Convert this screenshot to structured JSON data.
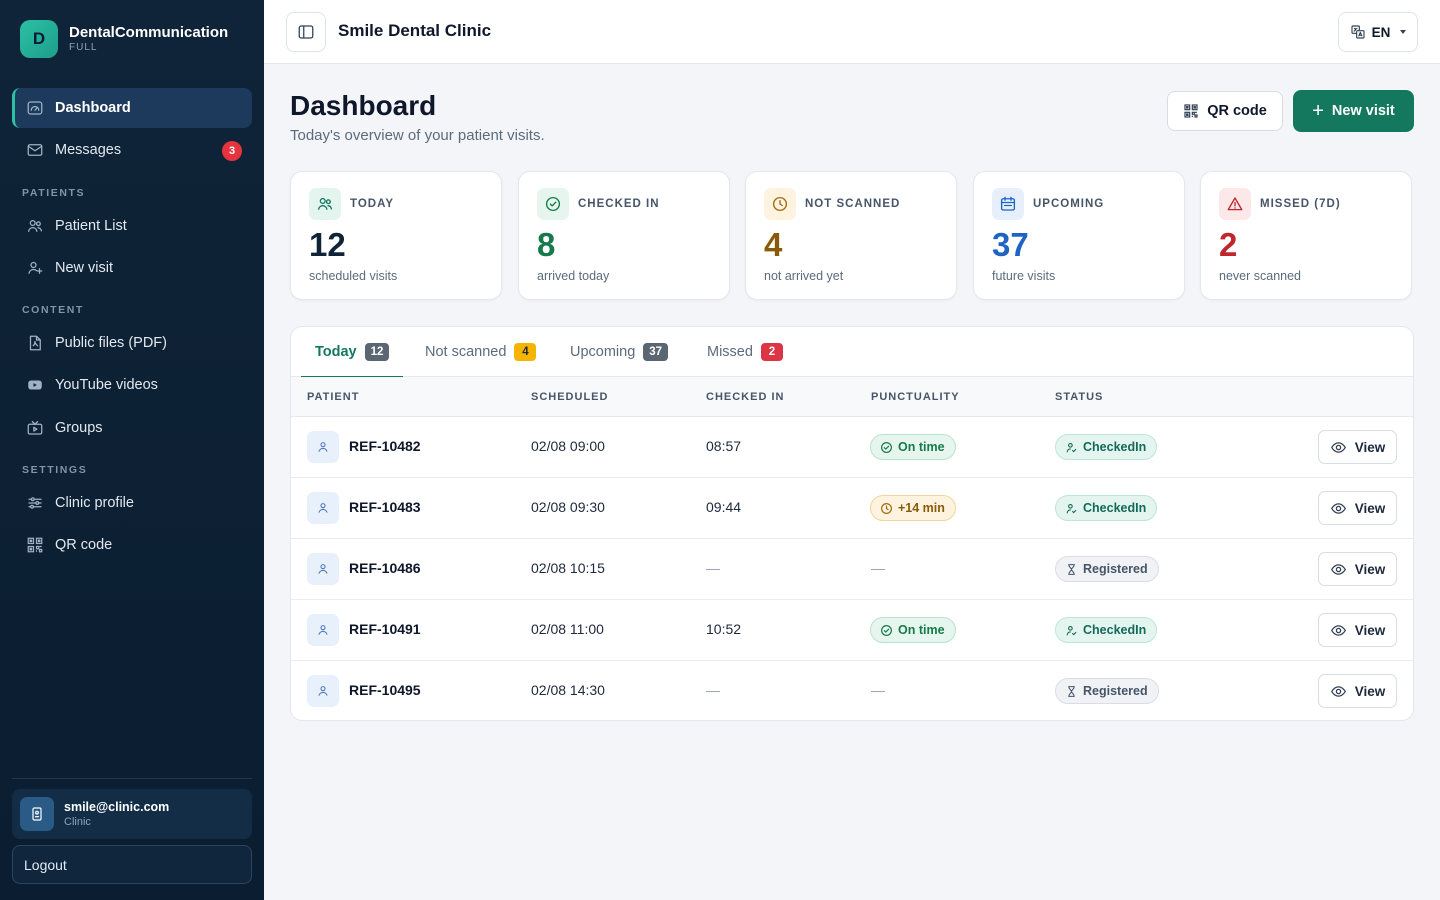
{
  "brand": {
    "initial": "D",
    "name": "DentalCommunication",
    "plan": "FULL"
  },
  "sidebar": {
    "dashboard": "Dashboard",
    "messages": "Messages",
    "messages_badge": "3",
    "section_patients": "PATIENTS",
    "patient_list": "Patient List",
    "new_visit": "New visit",
    "section_content": "CONTENT",
    "public_files": "Public files (PDF)",
    "youtube": "YouTube videos",
    "groups": "Groups",
    "section_settings": "SETTINGS",
    "clinic_profile": "Clinic profile",
    "qr_code": "QR code"
  },
  "user": {
    "email": "smile@clinic.com",
    "role": "Clinic"
  },
  "logout_label": "Logout",
  "topbar": {
    "clinic_name": "Smile Dental Clinic",
    "lang": "EN"
  },
  "page": {
    "title": "Dashboard",
    "subtitle": "Today's overview of your patient visits.",
    "qr_button": "QR code",
    "new_visit_button": "New visit"
  },
  "stats": [
    {
      "label": "TODAY",
      "value": "12",
      "desc": "scheduled visits",
      "color": "#0f2438"
    },
    {
      "label": "CHECKED IN",
      "value": "8",
      "desc": "arrived today",
      "color": "#167a4a"
    },
    {
      "label": "NOT SCANNED",
      "value": "4",
      "desc": "not arrived yet",
      "color": "#8a5a0b"
    },
    {
      "label": "UPCOMING",
      "value": "37",
      "desc": "future visits",
      "color": "#1f63c4"
    },
    {
      "label": "MISSED (7D)",
      "value": "2",
      "desc": "never scanned",
      "color": "#c0262d"
    }
  ],
  "tabs": [
    {
      "label": "Today",
      "count": "12"
    },
    {
      "label": "Not scanned",
      "count": "4"
    },
    {
      "label": "Upcoming",
      "count": "37"
    },
    {
      "label": "Missed",
      "count": "2"
    }
  ],
  "table": {
    "headers": [
      "PATIENT",
      "SCHEDULED",
      "CHECKED IN",
      "PUNCTUALITY",
      "STATUS"
    ],
    "view_label": "View",
    "rows": [
      {
        "ref": "REF-10482",
        "scheduled": "02/08 09:00",
        "checked_in": "08:57",
        "punctuality": "On time",
        "status": "CheckedIn"
      },
      {
        "ref": "REF-10483",
        "scheduled": "02/08 09:30",
        "checked_in": "09:44",
        "punctuality": "+14 min",
        "status": "CheckedIn"
      },
      {
        "ref": "REF-10486",
        "scheduled": "02/08 10:15",
        "checked_in": "—",
        "punctuality": "—",
        "status": "Registered"
      },
      {
        "ref": "REF-10491",
        "scheduled": "02/08 11:00",
        "checked_in": "10:52",
        "punctuality": "On time",
        "status": "CheckedIn"
      },
      {
        "ref": "REF-10495",
        "scheduled": "02/08 14:30",
        "checked_in": "—",
        "punctuality": "—",
        "status": "Registered"
      }
    ]
  }
}
